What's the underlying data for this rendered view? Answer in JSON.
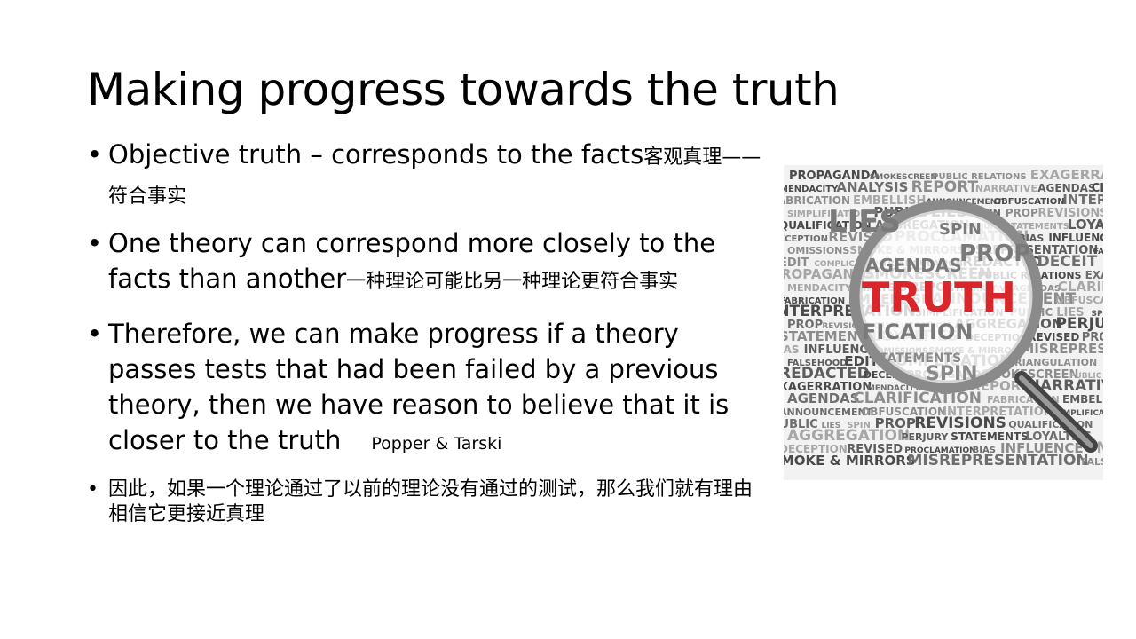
{
  "slide": {
    "title": "Making progress towards the truth",
    "bullets": [
      {
        "en": "Objective truth – corresponds to the facts",
        "zh": "客观真理——符合事实"
      },
      {
        "en": "One theory can correspond more closely to the facts than another",
        "zh": "一种理论可能比另一种理论更符合事实"
      },
      {
        "en": "Therefore, we can make progress if a theory passes tests that had been failed by a previous theory, then we have reason to believe that it is closer to the truth",
        "attribution": "Popper & Tarski"
      },
      {
        "zh": "因此，如果一个理论通过了以前的理论没有通过的测试，那么我们就有理由相信它更接近真理"
      }
    ],
    "image": {
      "icon": "magnifying-glass-icon",
      "focus_word": "TRUTH",
      "words": [
        "PROPAGANDA",
        "SMOKESCREEN",
        "PUBLIC RELATIONS",
        "EXAGERRATION",
        "MENDACITY",
        "ANALYSIS",
        "REPORT",
        "NARRATIVE",
        "AGENDAS",
        "CLARIFICATION",
        "FABRICATION",
        "EMBELLISH",
        "ANNOUNCEMENT",
        "OBFUSCATION",
        "INTERPRETATION",
        "SIMPLIFICATION",
        "PUBLIC",
        "LIES",
        "SPIN",
        "PROP",
        "REVISIONS",
        "QUALIFICATION",
        "AGGREGATION",
        "PERJURY",
        "STATEMENTS",
        "LOYALTIES",
        "DECEPTION",
        "REVISED",
        "PROCLAMATION",
        "BIAS",
        "INFLUENCE",
        "OMISSIONS",
        "SMOKE & MIRRORS",
        "MISREPRESENTATION",
        "FALSEHOOD",
        "EDIT",
        "COMPLICATION",
        "TRIANGULATION",
        "REDACTED",
        "DECEIT"
      ]
    },
    "colors": {
      "text": "#000000",
      "background": "#ffffff",
      "truth_red": "#d9262b",
      "word_gray": "#6e6e6e"
    }
  }
}
